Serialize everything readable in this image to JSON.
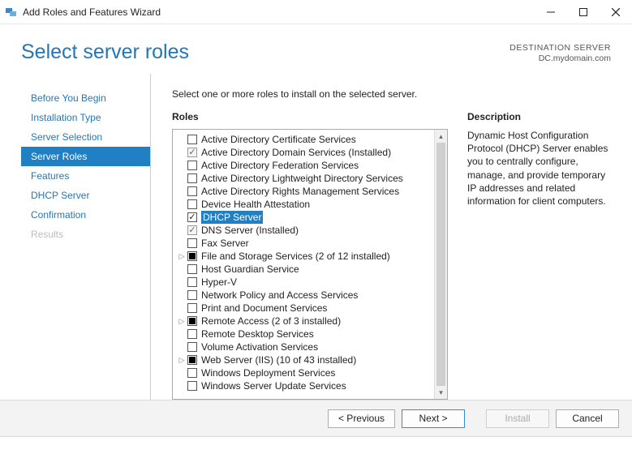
{
  "window": {
    "title": "Add Roles and Features Wizard"
  },
  "header": {
    "title": "Select server roles",
    "dest_label": "DESTINATION SERVER",
    "dest_value": "DC.mydomain.com"
  },
  "nav": {
    "items": [
      {
        "label": "Before You Begin"
      },
      {
        "label": "Installation Type"
      },
      {
        "label": "Server Selection"
      },
      {
        "label": "Server Roles",
        "current": true
      },
      {
        "label": "Features"
      },
      {
        "label": "DHCP Server"
      },
      {
        "label": "Confirmation"
      },
      {
        "label": "Results",
        "disabled": true
      }
    ]
  },
  "main": {
    "instruction": "Select one or more roles to install on the selected server.",
    "roles_heading": "Roles",
    "desc_heading": "Description",
    "description": "Dynamic Host Configuration Protocol (DHCP) Server enables you to centrally configure, manage, and provide temporary IP addresses and related information for client computers.",
    "roles": [
      {
        "label": "Active Directory Certificate Services"
      },
      {
        "label": "Active Directory Domain Services (Installed)",
        "state": "checked-gray"
      },
      {
        "label": "Active Directory Federation Services"
      },
      {
        "label": "Active Directory Lightweight Directory Services"
      },
      {
        "label": "Active Directory Rights Management Services"
      },
      {
        "label": "Device Health Attestation"
      },
      {
        "label": "DHCP Server",
        "state": "checked",
        "selected": true
      },
      {
        "label": "DNS Server (Installed)",
        "state": "checked-gray"
      },
      {
        "label": "Fax Server"
      },
      {
        "label": "File and Storage Services (2 of 12 installed)",
        "state": "partial",
        "expandable": true
      },
      {
        "label": "Host Guardian Service"
      },
      {
        "label": "Hyper-V"
      },
      {
        "label": "Network Policy and Access Services"
      },
      {
        "label": "Print and Document Services"
      },
      {
        "label": "Remote Access (2 of 3 installed)",
        "state": "partial",
        "expandable": true
      },
      {
        "label": "Remote Desktop Services"
      },
      {
        "label": "Volume Activation Services"
      },
      {
        "label": "Web Server (IIS) (10 of 43 installed)",
        "state": "partial",
        "expandable": true
      },
      {
        "label": "Windows Deployment Services"
      },
      {
        "label": "Windows Server Update Services"
      }
    ]
  },
  "footer": {
    "previous": "< Previous",
    "next": "Next >",
    "install": "Install",
    "cancel": "Cancel"
  }
}
